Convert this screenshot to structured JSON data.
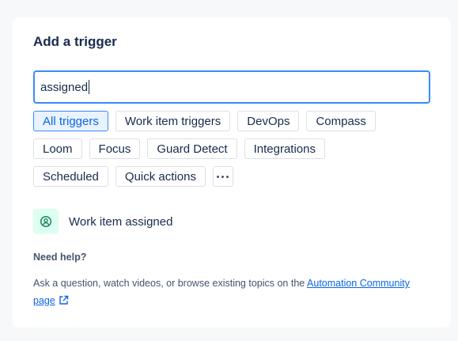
{
  "dialog": {
    "title": "Add a trigger"
  },
  "search": {
    "value": "assigned"
  },
  "filters": [
    {
      "label": "All triggers",
      "selected": true
    },
    {
      "label": "Work item triggers",
      "selected": false
    },
    {
      "label": "DevOps",
      "selected": false
    },
    {
      "label": "Compass",
      "selected": false
    },
    {
      "label": "Loom",
      "selected": false
    },
    {
      "label": "Focus",
      "selected": false
    },
    {
      "label": "Guard Detect",
      "selected": false
    },
    {
      "label": "Integrations",
      "selected": false
    },
    {
      "label": "Scheduled",
      "selected": false
    },
    {
      "label": "Quick actions",
      "selected": false
    }
  ],
  "more_filters_icon": "more-horizontal-icon",
  "results": [
    {
      "label": "Work item assigned",
      "icon": "user-avatar-circle-icon",
      "icon_color": "#1f845a",
      "icon_bg": "#dcfff1"
    }
  ],
  "help": {
    "heading": "Need help?",
    "text": "Ask a question, watch videos, or browse existing topics on the ",
    "link_text": "Automation Community page",
    "link_icon": "external-link-icon"
  },
  "colors": {
    "accent": "#0c66e4",
    "focus_border": "#388bff",
    "selected_bg": "#e9f2ff"
  }
}
